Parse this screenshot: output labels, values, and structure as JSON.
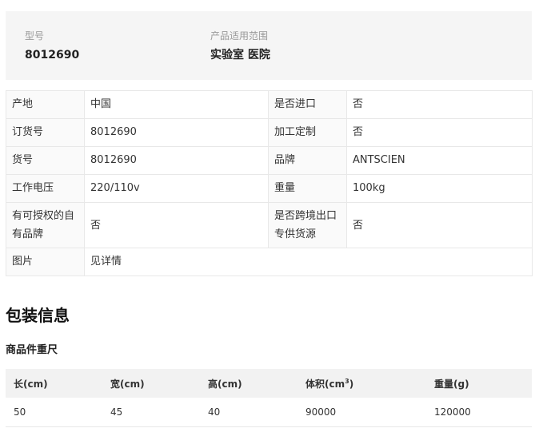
{
  "summary": {
    "model_label": "型号",
    "model_value": "8012690",
    "scope_label": "产品适用范围",
    "scope_value": "实验室 医院"
  },
  "specs": [
    {
      "k1": "产地",
      "v1": "中国",
      "k2": "是否进口",
      "v2": "否"
    },
    {
      "k1": "订货号",
      "v1": "8012690",
      "k2": "加工定制",
      "v2": "否"
    },
    {
      "k1": "货号",
      "v1": "8012690",
      "k2": "品牌",
      "v2": "ANTSCIEN"
    },
    {
      "k1": "工作电压",
      "v1": "220/110v",
      "k2": "重量",
      "v2": "100kg"
    },
    {
      "k1": "有可授权的自有品牌",
      "v1": "否",
      "k2": "是否跨境出口专供货源",
      "v2": "否"
    },
    {
      "k1": "图片",
      "v1": "见详情"
    }
  ],
  "packaging": {
    "title": "包装信息",
    "subtitle": "商品件重尺",
    "headers": {
      "length": "长(cm)",
      "width": "宽(cm)",
      "height": "高(cm)",
      "volume_prefix": "体积(cm",
      "volume_sup": "3",
      "volume_suffix": ")",
      "weight": "重量(g)"
    },
    "row": {
      "length": "50",
      "width": "45",
      "height": "40",
      "volume": "90000",
      "weight": "120000"
    }
  }
}
